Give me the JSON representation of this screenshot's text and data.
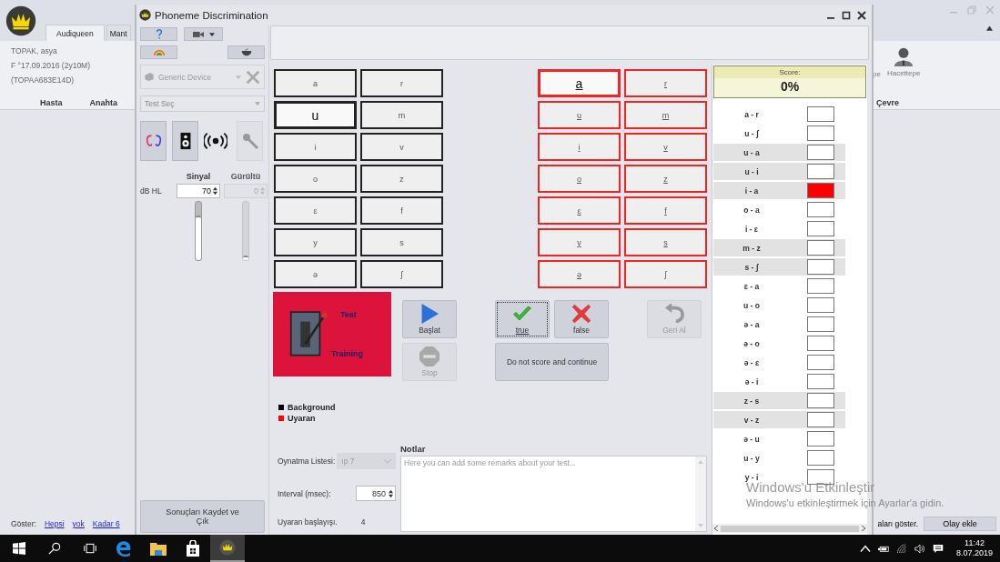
{
  "main_window": {
    "tabs": [
      {
        "label": "Audiqueen",
        "selected": true
      },
      {
        "label": "Mant",
        "selected": false
      }
    ],
    "patient": {
      "name": "TOPAK, asya",
      "birth": "F °17.09.2016 (2y10M)",
      "code": "(TOPAA683E14D)"
    },
    "ribbon_groups": [
      "Hasta",
      "Anahta"
    ],
    "ribbon_right": {
      "cut_label": "pe",
      "button": "Hacettepe",
      "group": "Çevre"
    },
    "footer": {
      "label": "Göster:",
      "links": [
        "Hepsi",
        "yok",
        "Kadar 6"
      ],
      "right_text": "aları göster.",
      "button": "Olay ekle"
    }
  },
  "dialog": {
    "title": "Phoneme Discrimination",
    "device": {
      "value": "Generic Device",
      "disabled": true
    },
    "test_select": {
      "placeholder": "Test Seç"
    },
    "output_buttons": [
      {
        "kind": "ears",
        "framed": true,
        "disabled": false
      },
      {
        "kind": "speaker",
        "framed": true,
        "disabled": false
      },
      {
        "kind": "broadcast",
        "framed": false,
        "disabled": false
      },
      {
        "kind": "microphone",
        "framed": true,
        "disabled": true
      }
    ],
    "levels": {
      "unit": "dB HL",
      "channels": [
        {
          "label": "Sinyal",
          "value": "70",
          "disabled": false,
          "level": 0.77
        },
        {
          "label": "Gürültü",
          "value": "0",
          "disabled": true,
          "level": 0
        }
      ]
    },
    "save_button": "Sonuçları Kaydet ve Çık",
    "stimulus_grid": [
      {
        "label": "a",
        "selected": false
      },
      {
        "label": "r",
        "selected": false
      },
      {
        "label": "u",
        "selected": true
      },
      {
        "label": "m",
        "selected": false
      },
      {
        "label": "i",
        "selected": false
      },
      {
        "label": "v",
        "selected": false
      },
      {
        "label": "o",
        "selected": false
      },
      {
        "label": "z",
        "selected": false
      },
      {
        "label": "ɛ",
        "selected": false
      },
      {
        "label": "f",
        "selected": false
      },
      {
        "label": "y",
        "selected": false
      },
      {
        "label": "s",
        "selected": false
      },
      {
        "label": "ə",
        "selected": false
      },
      {
        "label": "ʃ",
        "selected": false
      }
    ],
    "response_grid": [
      {
        "label": "a",
        "selected": true
      },
      {
        "label": "r",
        "selected": false
      },
      {
        "label": "u",
        "selected": false
      },
      {
        "label": "m",
        "selected": false
      },
      {
        "label": "i",
        "selected": false
      },
      {
        "label": "v",
        "selected": false
      },
      {
        "label": "o",
        "selected": false
      },
      {
        "label": "z",
        "selected": false
      },
      {
        "label": "ɛ",
        "selected": false
      },
      {
        "label": "f",
        "selected": false
      },
      {
        "label": "y",
        "selected": false
      },
      {
        "label": "s",
        "selected": false
      },
      {
        "label": "ə",
        "selected": false
      },
      {
        "label": "ʃ",
        "selected": false
      }
    ],
    "mode_switch": {
      "top_label": "Test",
      "bottom_label": "Training",
      "test_on": true
    },
    "buttons": [
      {
        "kind": "start",
        "label": "Başlat",
        "disabled": false,
        "focused": false
      },
      {
        "kind": "stop",
        "label": "Stop",
        "disabled": true,
        "focused": false
      },
      {
        "kind": "true",
        "label": "true",
        "disabled": false,
        "focused": true
      },
      {
        "kind": "false",
        "label": "false",
        "disabled": false,
        "focused": false
      },
      {
        "kind": "skip",
        "label": "Do not score and continue",
        "disabled": false,
        "focused": false
      },
      {
        "kind": "undo",
        "label": "Geri Al",
        "disabled": true,
        "focused": false
      }
    ],
    "legend": [
      {
        "label": "Background",
        "color": "#000000"
      },
      {
        "label": "Uyaran",
        "color": "#ff0000"
      }
    ],
    "playlist": {
      "label": "Oynatma Listesi:",
      "value": "ıp 7",
      "disabled": true
    },
    "interval": {
      "label": "Interval (msec):",
      "value": "850"
    },
    "onset": {
      "label": "Uyaran başlayışı.",
      "value": "4"
    },
    "notes": {
      "label": "Notlar",
      "placeholder": "Here you can add some remarks about your test..."
    },
    "score": {
      "label": "Score:",
      "value": "0%",
      "pairs": [
        {
          "label": "a - r",
          "highlighted": false,
          "wrong": false
        },
        {
          "label": "u - ʃ",
          "highlighted": false,
          "wrong": false
        },
        {
          "label": "u - a",
          "highlighted": true,
          "wrong": false
        },
        {
          "label": "u - i",
          "highlighted": true,
          "wrong": false
        },
        {
          "label": "i - a",
          "highlighted": true,
          "wrong": true
        },
        {
          "label": "o - a",
          "highlighted": false,
          "wrong": false
        },
        {
          "label": "i - ɛ",
          "highlighted": false,
          "wrong": false
        },
        {
          "label": "m - z",
          "highlighted": true,
          "wrong": false
        },
        {
          "label": "s - ʃ",
          "highlighted": true,
          "wrong": false
        },
        {
          "label": "ɛ - a",
          "highlighted": false,
          "wrong": false
        },
        {
          "label": "u - o",
          "highlighted": false,
          "wrong": false
        },
        {
          "label": "ə - a",
          "highlighted": false,
          "wrong": false
        },
        {
          "label": "ə - o",
          "highlighted": false,
          "wrong": false
        },
        {
          "label": "ə - ɛ",
          "highlighted": false,
          "wrong": false
        },
        {
          "label": "ə - i",
          "highlighted": false,
          "wrong": false
        },
        {
          "label": "z - s",
          "highlighted": true,
          "wrong": false
        },
        {
          "label": "v - z",
          "highlighted": true,
          "wrong": false
        },
        {
          "label": "ə - u",
          "highlighted": false,
          "wrong": false
        },
        {
          "label": "u - y",
          "highlighted": false,
          "wrong": false
        },
        {
          "label": "y - i",
          "highlighted": false,
          "wrong": false
        }
      ]
    }
  },
  "activation_notice": {
    "title": "Windows'u Etkinleştir",
    "text": "Windows'u etkinleştirmek için Ayarlar'a gidin."
  },
  "taskbar": {
    "apps": [
      {
        "kind": "edge",
        "active": false
      },
      {
        "kind": "folder",
        "active": false
      },
      {
        "kind": "store",
        "active": false
      },
      {
        "kind": "crown",
        "active": true
      }
    ],
    "time": "11:42",
    "date": "8.07.2019"
  }
}
